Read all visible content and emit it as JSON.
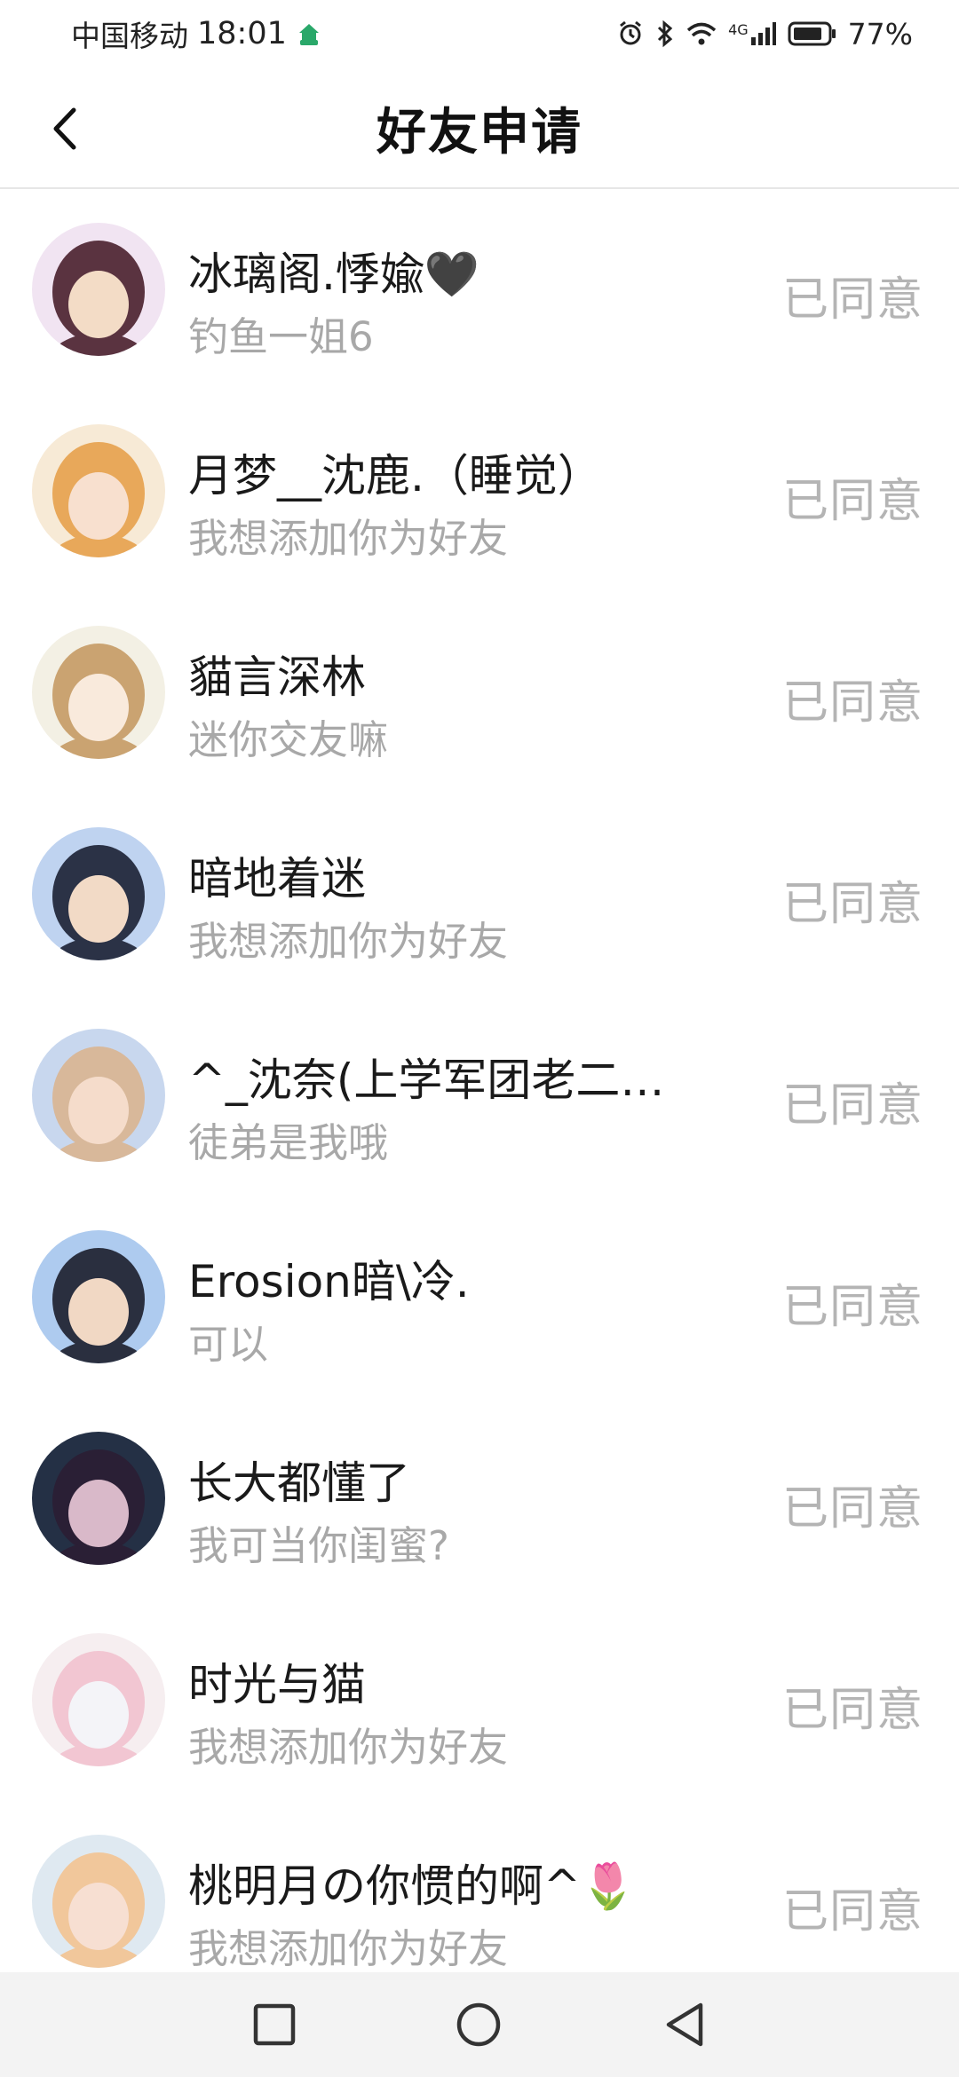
{
  "status_bar": {
    "carrier": "中国移动",
    "time": "18:01",
    "network": "4G",
    "battery": "77%",
    "icons": [
      "app-home-icon",
      "alarm-icon",
      "bluetooth-icon",
      "wifi-icon",
      "signal-icon",
      "battery-icon"
    ]
  },
  "header": {
    "title": "好友申请",
    "back_icon": "chevron-left-icon"
  },
  "requests": [
    {
      "name": "冰璃阁.悸婾🖤",
      "message": "钓鱼一姐6",
      "status": "已同意",
      "avatar_colors": [
        "#f1e4f2",
        "#5a3340",
        "#f3dcc6"
      ]
    },
    {
      "name": "月梦__沈鹿.（睡觉）",
      "message": "我想添加你为好友",
      "status": "已同意",
      "avatar_colors": [
        "#f7ead6",
        "#e8a85a",
        "#f8e0cf"
      ]
    },
    {
      "name": "貓言深林",
      "message": "迷你交友嘛",
      "status": "已同意",
      "avatar_colors": [
        "#f3f0e4",
        "#caa371",
        "#f9eadc"
      ]
    },
    {
      "name": "暗地着迷",
      "message": "我想添加你为好友",
      "status": "已同意",
      "avatar_colors": [
        "#bfd3f0",
        "#2b3246",
        "#f2dac6"
      ]
    },
    {
      "name": "^_沈奈(上学军团老二…",
      "message": "徒弟是我哦",
      "status": "已同意",
      "avatar_colors": [
        "#c8d7ee",
        "#d8b89a",
        "#f5dccb"
      ]
    },
    {
      "name": "Erosion暗\\冷.",
      "message": "可以",
      "status": "已同意",
      "avatar_colors": [
        "#aecbef",
        "#2a2f3f",
        "#f1d8c4"
      ]
    },
    {
      "name": "长大都懂了",
      "message": "我可当你闺蜜?",
      "status": "已同意",
      "avatar_colors": [
        "#243045",
        "#2a1f35",
        "#d9b9c9"
      ]
    },
    {
      "name": "时光与猫",
      "message": "我想添加你为好友",
      "status": "已同意",
      "avatar_colors": [
        "#f6eef0",
        "#f2c6d2",
        "#f4f4f8"
      ]
    },
    {
      "name": "桃明月の你惯的啊^🌷",
      "message": "我想添加你为好友",
      "status": "已同意",
      "avatar_colors": [
        "#dfe9f1",
        "#f1c79b",
        "#f7dfd2"
      ]
    }
  ],
  "nav_bar": {
    "icons": [
      "recent-apps-icon",
      "home-icon",
      "back-icon"
    ]
  }
}
